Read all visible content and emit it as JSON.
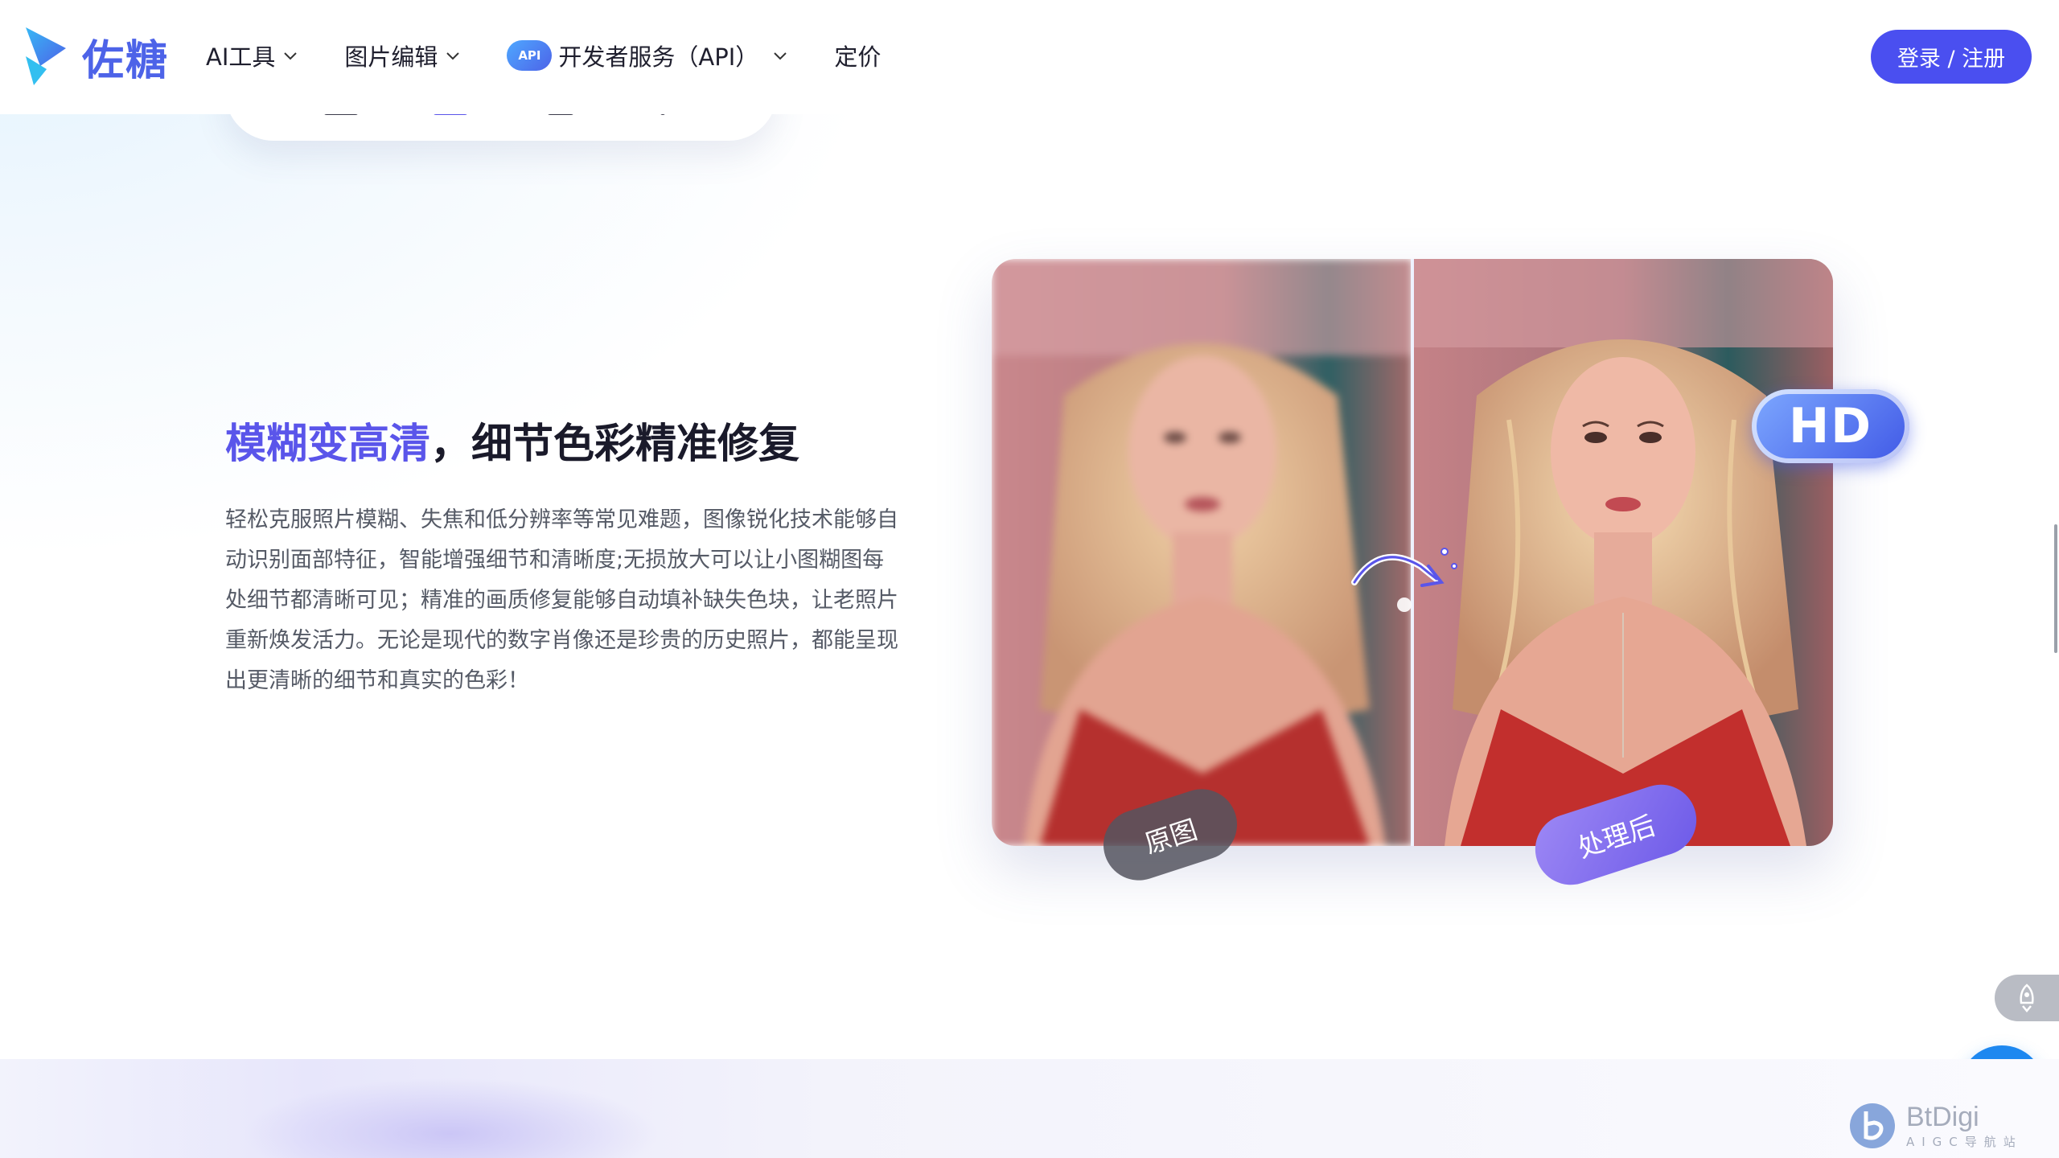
{
  "brand": {
    "name": "佐糖"
  },
  "nav": {
    "items": [
      {
        "label": "AI工具",
        "has_dropdown": true
      },
      {
        "label": "图片编辑",
        "has_dropdown": true
      },
      {
        "label": "开发者服务（API）",
        "has_dropdown": true,
        "badge": "API"
      },
      {
        "label": "定价",
        "has_dropdown": false
      }
    ],
    "login_label": "登录 / 注册"
  },
  "feature": {
    "headline_highlight": "模糊变高清",
    "headline_rest": "，细节色彩精准修复",
    "description": "轻松克服照片模糊、失焦和低分辨率等常见难题，图像锐化技术能够自动识别面部特征，智能增强细节和清晰度;无损放大可以让小图糊图每处细节都清晰可见；精准的画质修复能够自动填补缺失色块，让老照片重新焕发活力。无论是现代的数字肖像还是珍贵的历史照片，都能呈现出更清晰的细节和真实的色彩！",
    "hd_badge": "HD",
    "tag_original": "原图",
    "tag_processed": "处理后"
  },
  "watermark": {
    "main": "BtDigi",
    "sub": "AIGC导航站"
  },
  "colors": {
    "accent": "#4a4ff0",
    "highlight": "#5a55ea",
    "chat": "#1e88f0"
  },
  "icons": [
    "logo-mark-icon",
    "chevron-down-icon",
    "rocket-icon",
    "chat-bubble-icon",
    "swap-arrow-icon"
  ]
}
